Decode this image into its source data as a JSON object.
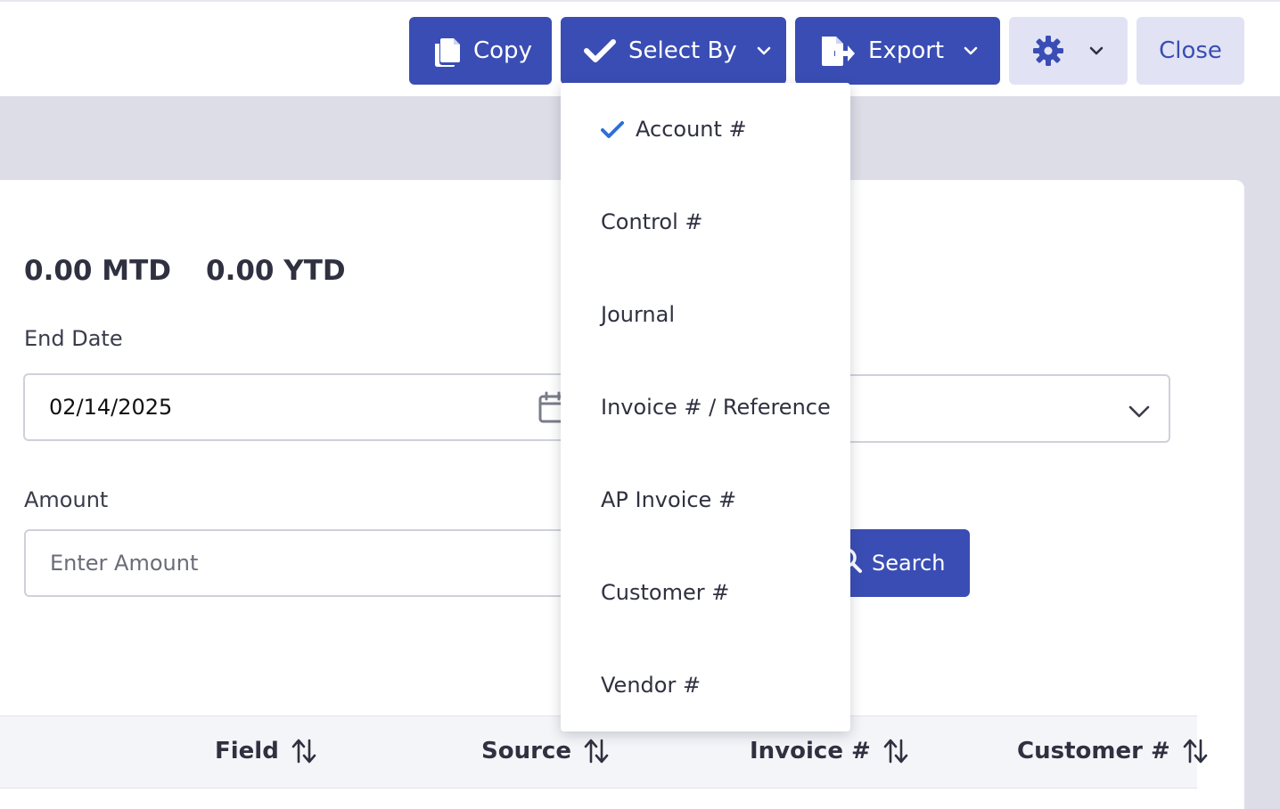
{
  "toolbar": {
    "copy_label": "Copy",
    "select_by_label": "Select By",
    "export_label": "Export",
    "close_label": "Close"
  },
  "summary": {
    "mtd": "0.00 MTD",
    "ytd": "0.00 YTD"
  },
  "form": {
    "end_date_label": "End Date",
    "end_date_value": "02/14/2025",
    "amount_label": "Amount",
    "amount_placeholder": "Enter Amount",
    "search_label": "Search"
  },
  "table": {
    "columns": [
      "Field",
      "Source",
      "Invoice #",
      "Customer #"
    ]
  },
  "select_by_menu": {
    "items": [
      "Account #",
      "Control #",
      "Journal",
      "Invoice # / Reference",
      "AP Invoice #",
      "Customer #",
      "Vendor #"
    ],
    "selected": "Account #"
  },
  "colors": {
    "primary": "#3a4db4",
    "secondary_button": "#e1e3f4",
    "check": "#2f6fd6",
    "backdrop": "#dcdde7"
  },
  "icons": [
    "copy-icon",
    "check-icon",
    "chevron-down-icon",
    "export-icon",
    "gear-icon",
    "calendar-icon",
    "search-icon",
    "sort-icon"
  ]
}
